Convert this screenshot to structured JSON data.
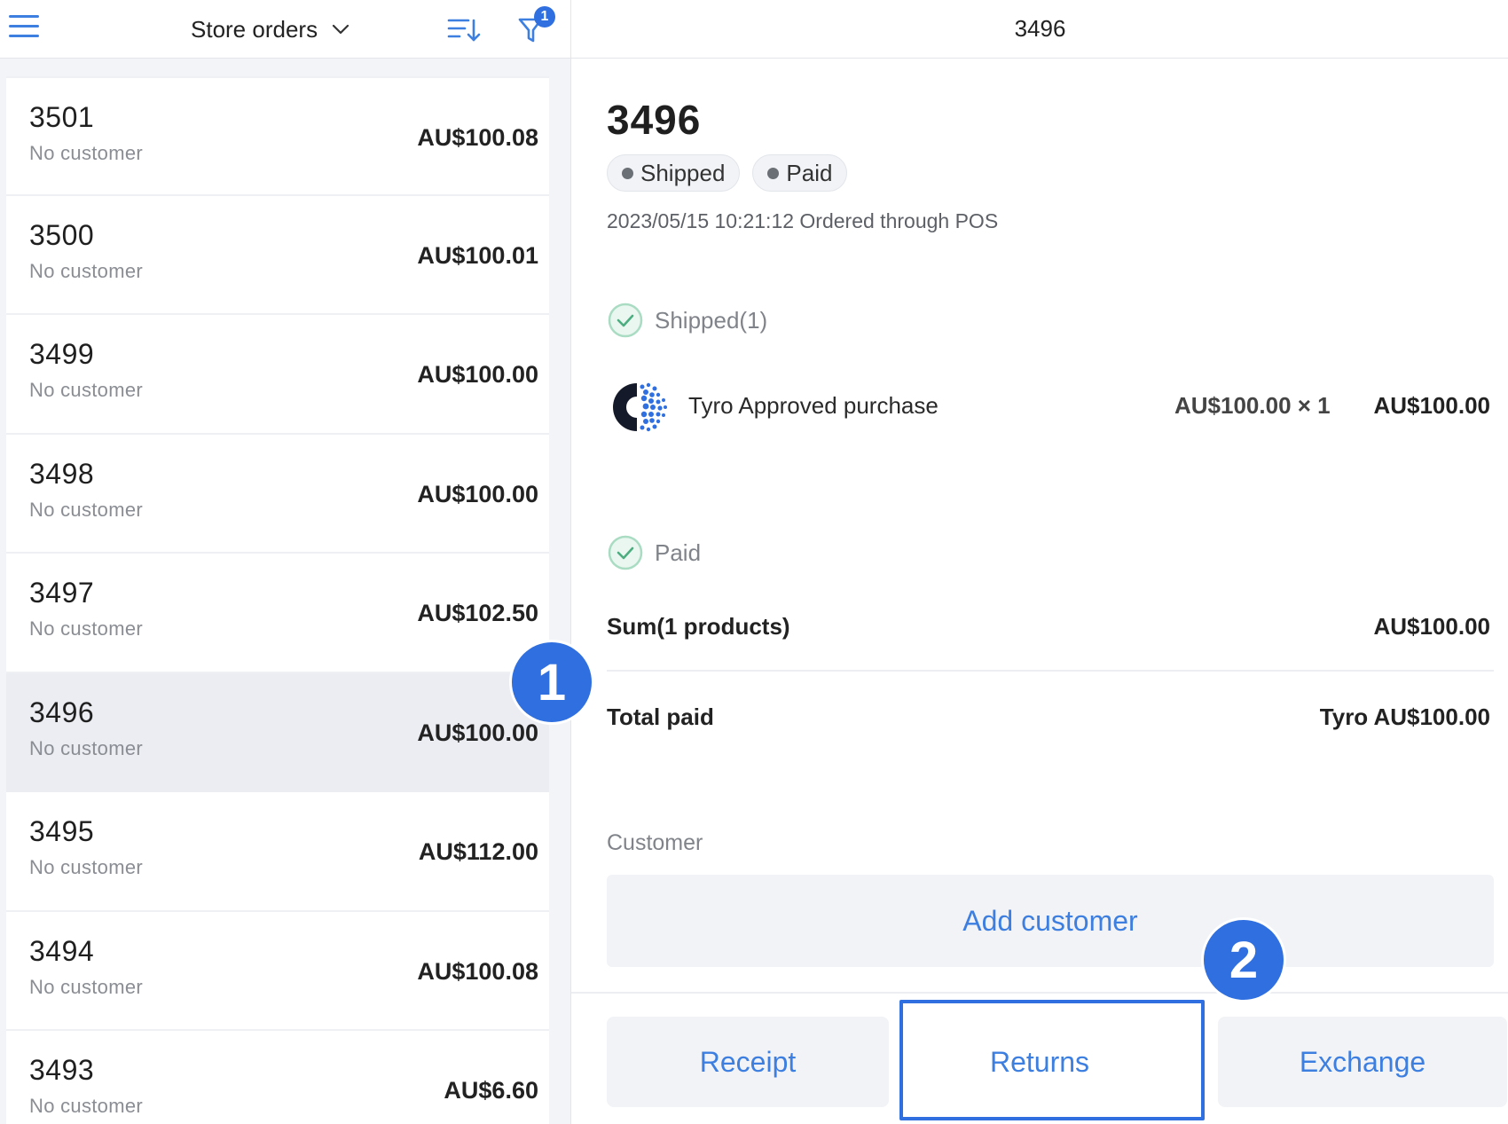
{
  "left_header": {
    "title": "Store orders",
    "filter_count": "1"
  },
  "orders": [
    {
      "number": "3501",
      "customer": "No customer",
      "amount": "AU$100.08",
      "selected": false
    },
    {
      "number": "3500",
      "customer": "No customer",
      "amount": "AU$100.01",
      "selected": false
    },
    {
      "number": "3499",
      "customer": "No customer",
      "amount": "AU$100.00",
      "selected": false
    },
    {
      "number": "3498",
      "customer": "No customer",
      "amount": "AU$100.00",
      "selected": false
    },
    {
      "number": "3497",
      "customer": "No customer",
      "amount": "AU$102.50",
      "selected": false
    },
    {
      "number": "3496",
      "customer": "No customer",
      "amount": "AU$100.00",
      "selected": true
    },
    {
      "number": "3495",
      "customer": "No customer",
      "amount": "AU$112.00",
      "selected": false
    },
    {
      "number": "3494",
      "customer": "No customer",
      "amount": "AU$100.08",
      "selected": false
    },
    {
      "number": "3493",
      "customer": "No customer",
      "amount": "AU$6.60",
      "selected": false
    }
  ],
  "detail": {
    "header_title": "3496",
    "order_number": "3496",
    "badges": [
      "Shipped",
      "Paid"
    ],
    "meta": "2023/05/15 10:21:12 Ordered through POS",
    "shipped_status": "Shipped(1)",
    "product": {
      "name": "Tyro Approved purchase",
      "qty_price": "AU$100.00 × 1",
      "total": "AU$100.00"
    },
    "paid_status": "Paid",
    "sum_label": "Sum(1 products)",
    "sum_value": "AU$100.00",
    "total_paid_label": "Total paid",
    "total_paid_value": "Tyro AU$100.00",
    "customer_label": "Customer",
    "add_customer_label": "Add customer"
  },
  "actions": {
    "receipt": "Receipt",
    "returns": "Returns",
    "exchange": "Exchange"
  },
  "callouts": {
    "step1": "1",
    "step2": "2"
  },
  "colors": {
    "accent": "#3d7fe0",
    "callout": "#2f6fe0",
    "selected_row": "#ebedf2",
    "success": "#5cbf8f"
  }
}
